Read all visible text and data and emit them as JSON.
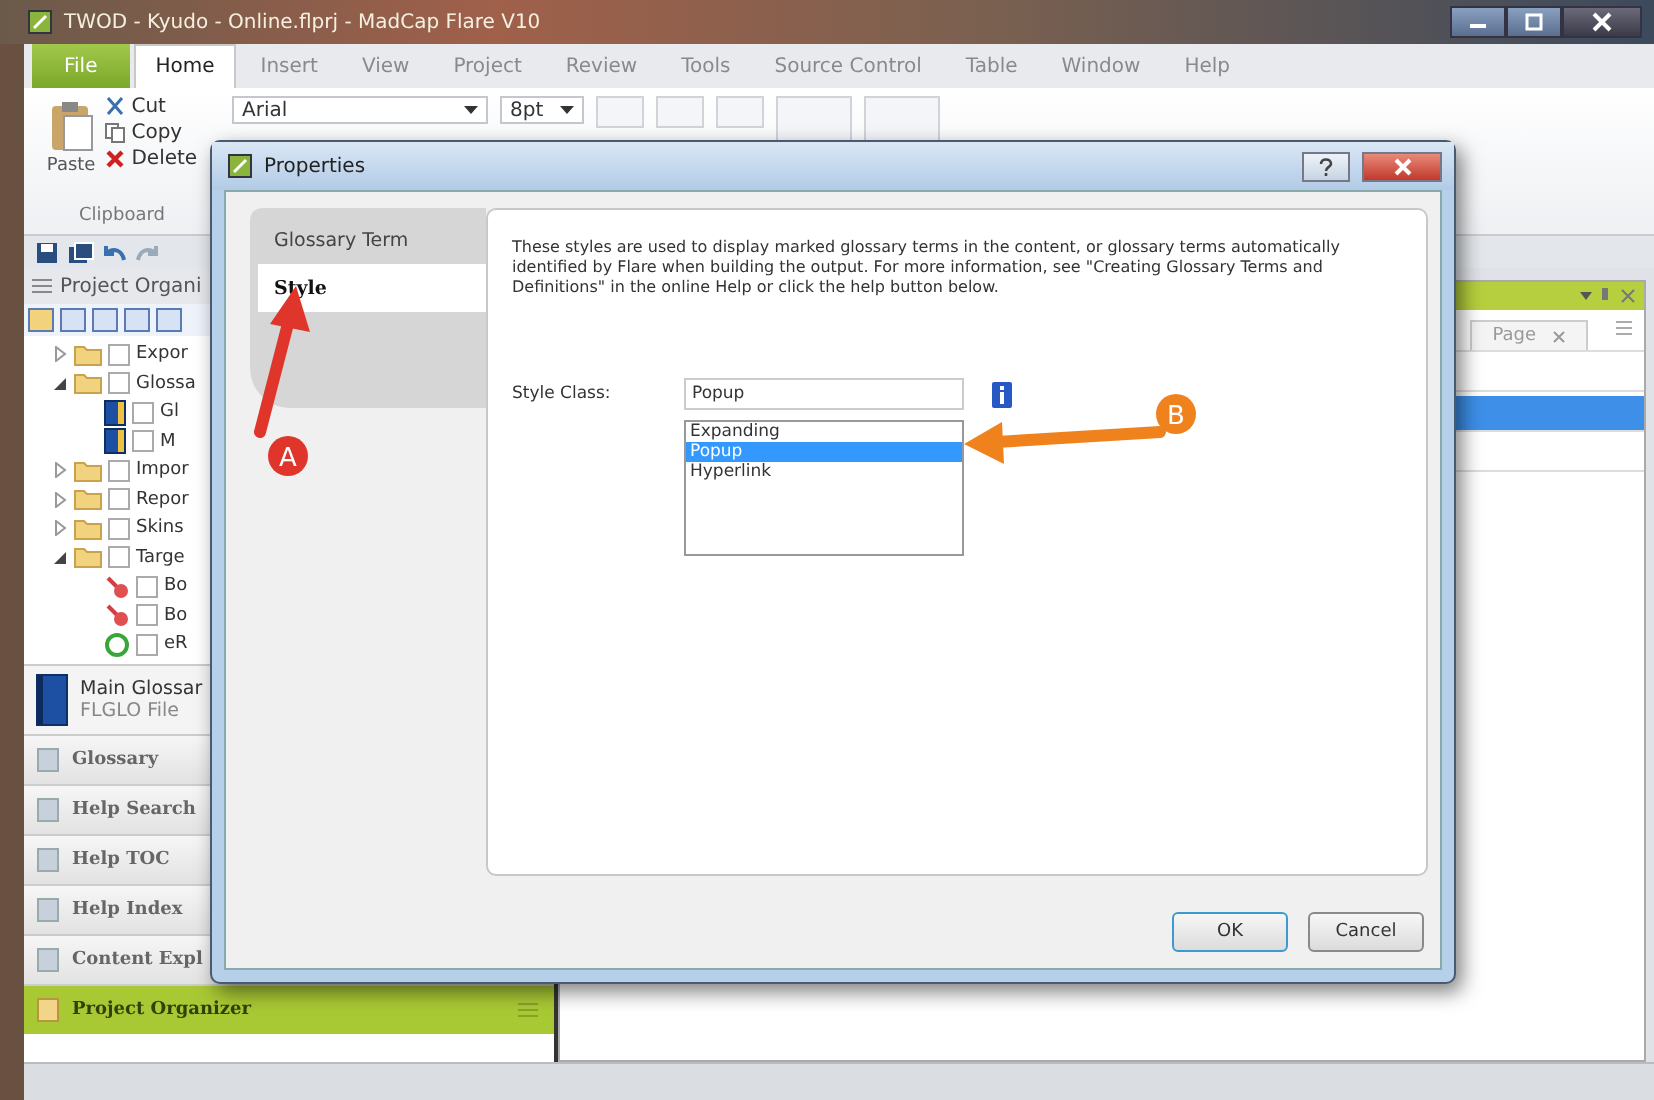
{
  "window": {
    "title": "TWOD - Kyudo - Online.flprj - MadCap Flare V10"
  },
  "ribbon_tabs": [
    {
      "label": "File",
      "kind": "file",
      "selected": false
    },
    {
      "label": "Home",
      "kind": "tab",
      "selected": true
    },
    {
      "label": "Insert",
      "kind": "tab",
      "selected": false
    },
    {
      "label": "View",
      "kind": "tab",
      "selected": false
    },
    {
      "label": "Project",
      "kind": "tab",
      "selected": false
    },
    {
      "label": "Review",
      "kind": "tab",
      "selected": false
    },
    {
      "label": "Tools",
      "kind": "tab",
      "selected": false
    },
    {
      "label": "Source Control",
      "kind": "tab",
      "selected": false
    },
    {
      "label": "Table",
      "kind": "tab",
      "selected": false
    },
    {
      "label": "Window",
      "kind": "tab",
      "selected": false
    },
    {
      "label": "Help",
      "kind": "tab",
      "selected": false
    }
  ],
  "ribbon": {
    "paste": "Paste",
    "cut": "Cut",
    "copy": "Copy",
    "delete": "Delete",
    "group": "Clipboard",
    "font": "Arial",
    "size": "8pt"
  },
  "project_organizer": {
    "title": "Project Organi",
    "tree": [
      {
        "label": "Expor",
        "kind": "folder",
        "expanded": false,
        "checked": false
      },
      {
        "label": "Glossa",
        "kind": "folder",
        "expanded": true,
        "checked": false,
        "children": [
          {
            "label": "Gl",
            "kind": "glossary",
            "checked": false
          },
          {
            "label": "M",
            "kind": "glossary",
            "checked": false
          }
        ]
      },
      {
        "label": "Impor",
        "kind": "folder",
        "expanded": false,
        "checked": false
      },
      {
        "label": "Repor",
        "kind": "folder",
        "expanded": false,
        "checked": false
      },
      {
        "label": "Skins",
        "kind": "folder",
        "expanded": false,
        "checked": false
      },
      {
        "label": "Targe",
        "kind": "folder",
        "expanded": true,
        "checked": false,
        "children": [
          {
            "label": "Bo",
            "kind": "target",
            "checked": false
          },
          {
            "label": "Bo",
            "kind": "target",
            "checked": false
          },
          {
            "label": "eR",
            "kind": "target-ok",
            "checked": false
          }
        ]
      }
    ],
    "preview": {
      "name": "Main Glossar",
      "type": "FLGLO File"
    }
  },
  "accordion": [
    {
      "label": "Glossary",
      "selected": false
    },
    {
      "label": "Help Search",
      "selected": false
    },
    {
      "label": "Help TOC",
      "selected": false
    },
    {
      "label": "Help Index",
      "selected": false
    },
    {
      "label": "Content Expl",
      "selected": false
    },
    {
      "label": "Project Organizer",
      "selected": true
    }
  ],
  "right_pane": {
    "tab": "Page",
    "rows": [
      {
        "selected": false
      },
      {
        "selected": true
      },
      {
        "selected": false
      }
    ]
  },
  "dialog": {
    "title": "Properties",
    "tabs": [
      {
        "label": "Glossary Term",
        "selected": false
      },
      {
        "label": "Style",
        "selected": true
      }
    ],
    "description": "These styles are used to display marked glossary terms in the content, or glossary terms automatically identified by Flare when building the output. For more information, see \"Creating Glossary Terms and Definitions\" in the online Help or click the help button below.",
    "field_label": "Style Class:",
    "field_value": "Popup",
    "options": [
      {
        "label": "Expanding",
        "selected": false
      },
      {
        "label": "Popup",
        "selected": true
      },
      {
        "label": "Hyperlink",
        "selected": false
      }
    ],
    "buttons": [
      {
        "label": "OK",
        "kind": "default"
      },
      {
        "label": "Cancel",
        "kind": "normal"
      }
    ]
  },
  "annotations": [
    {
      "label": "A",
      "color": "#e0352b"
    },
    {
      "label": "B",
      "color": "#f0821e"
    }
  ]
}
